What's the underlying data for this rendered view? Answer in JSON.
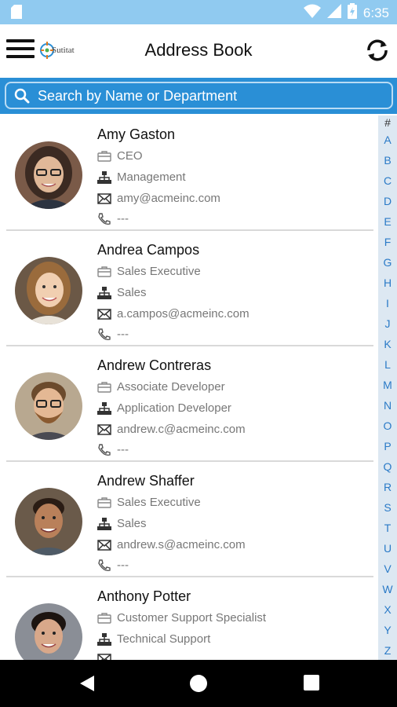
{
  "status_bar": {
    "time": "6:35",
    "icons": [
      "sd-card-icon",
      "wifi-icon",
      "signal-icon",
      "battery-icon"
    ]
  },
  "header": {
    "title": "Address Book",
    "logo_text": "Sutitat",
    "icons": {
      "menu": "menu-icon",
      "refresh": "sync-icon"
    }
  },
  "search": {
    "placeholder": "Search by Name or Department",
    "value": ""
  },
  "contacts": [
    {
      "name": "Amy Gaston",
      "title": "CEO",
      "department": "Management",
      "email": "amy@acmeinc.com",
      "phone": "---"
    },
    {
      "name": "Andrea Campos",
      "title": "Sales Executive",
      "department": "Sales",
      "email": "a.campos@acmeinc.com",
      "phone": "---"
    },
    {
      "name": "Andrew Contreras",
      "title": "Associate Developer",
      "department": "Application Developer",
      "email": "andrew.c@acmeinc.com",
      "phone": "---"
    },
    {
      "name": "Andrew Shaffer",
      "title": "Sales Executive",
      "department": "Sales",
      "email": "andrew.s@acmeinc.com",
      "phone": "---"
    },
    {
      "name": "Anthony Potter",
      "title": "Customer Support Specialist",
      "department": "Technical Support",
      "email": "",
      "phone": ""
    }
  ],
  "index_letters": [
    "#",
    "A",
    "B",
    "C",
    "D",
    "E",
    "F",
    "G",
    "H",
    "I",
    "J",
    "K",
    "L",
    "M",
    "N",
    "O",
    "P",
    "Q",
    "R",
    "S",
    "T",
    "U",
    "V",
    "W",
    "X",
    "Y",
    "Z"
  ],
  "colors": {
    "status_bar": "#90caf0",
    "accent": "#2a8fd6",
    "index_bar": "#dde8f2",
    "index_text": "#2a7ac7"
  }
}
